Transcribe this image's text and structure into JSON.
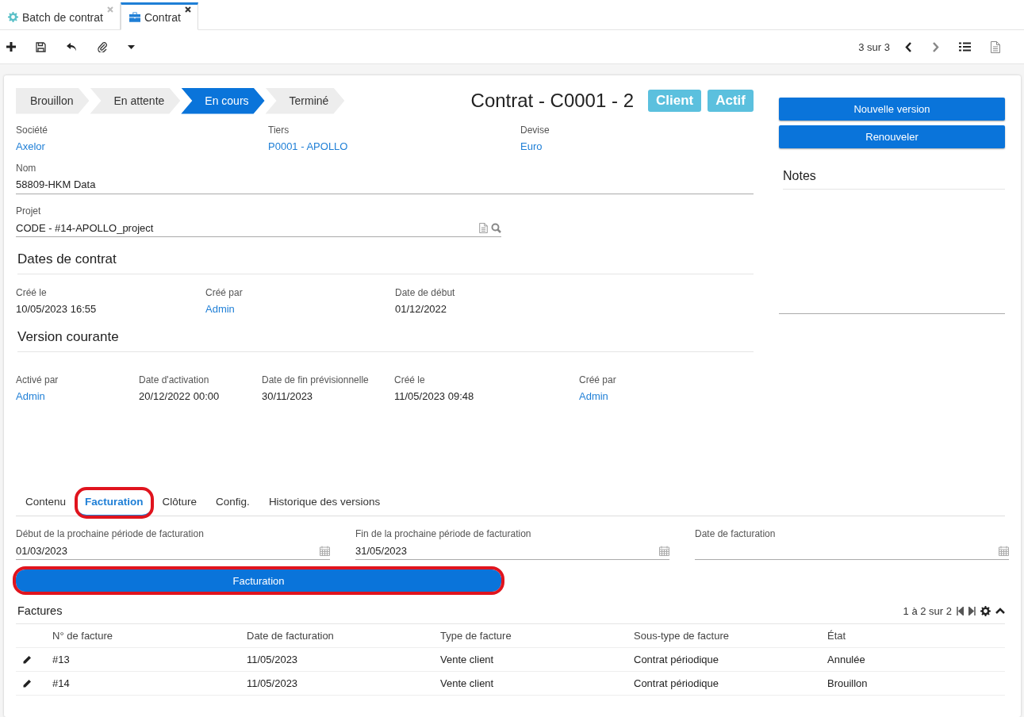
{
  "window_tabs": [
    {
      "label": "Batch de contrat",
      "kind": "batch",
      "selected": false
    },
    {
      "label": "Contrat",
      "kind": "record",
      "selected": true
    }
  ],
  "toolbar": {
    "pager": "3 sur 3"
  },
  "status_steps": [
    {
      "label": "Brouillon",
      "selected": false
    },
    {
      "label": "En attente",
      "selected": false
    },
    {
      "label": "En cours",
      "selected": true
    },
    {
      "label": "Terminé",
      "selected": false
    }
  ],
  "title": "Contrat - C0001 - 2",
  "tags": [
    "Client",
    "Actif"
  ],
  "main_fields": [
    {
      "label": "Société",
      "value": "Axelor",
      "link": true
    },
    {
      "label": "Tiers",
      "value": "P0001 - APOLLO",
      "link": true
    },
    {
      "label": "Devise",
      "value": "Euro",
      "link": true
    }
  ],
  "name_field": {
    "label": "Nom",
    "value": "58809-HKM Data"
  },
  "project_field": {
    "label": "Projet",
    "value": "CODE - #14-APOLLO_project"
  },
  "sections": [
    {
      "title": "Dates de contrat",
      "fields": [
        {
          "label": "Créé le",
          "value": "10/05/2023 16:55",
          "link": false
        },
        {
          "label": "Créé par",
          "value": "Admin",
          "link": true
        },
        {
          "label": "Date de début",
          "value": "01/12/2022",
          "link": false
        }
      ]
    },
    {
      "title": "Version courante",
      "fields": [
        {
          "label": "Activé par",
          "value": "Admin",
          "link": true
        },
        {
          "label": "Date d'activation",
          "value": "20/12/2022 00:00",
          "link": false
        },
        {
          "label": "Date de fin prévisionnelle",
          "value": "30/11/2023",
          "link": false
        },
        {
          "label": "Créé le",
          "value": "11/05/2023 09:48",
          "link": false
        },
        {
          "label": "Créé par",
          "value": "Admin",
          "link": true
        }
      ]
    }
  ],
  "side_buttons": [
    "Nouvelle version",
    "Renouveler"
  ],
  "notes_title": "Notes",
  "form_tabs": [
    {
      "label": "Contenu",
      "selected": false,
      "highlighted": false
    },
    {
      "label": "Facturation",
      "selected": true,
      "highlighted": true
    },
    {
      "label": "Clôture",
      "selected": false,
      "highlighted": false
    },
    {
      "label": "Config.",
      "selected": false,
      "highlighted": false
    },
    {
      "label": "Historique des versions",
      "selected": false,
      "highlighted": false
    }
  ],
  "billing_fields": [
    {
      "label": "Début de la prochaine période de facturation",
      "value": "01/03/2023"
    },
    {
      "label": "Fin de la prochaine période de facturation",
      "value": "31/05/2023"
    },
    {
      "label": "Date de facturation"
    }
  ],
  "billing_button": {
    "label": "Facturation",
    "highlighted": true
  },
  "invoices": {
    "title": "Factures",
    "pager": "1 à 2 sur 2",
    "columns": [
      "N° de facture",
      "Date de facturation",
      "Type de facture",
      "Sous-type de facture",
      "État"
    ],
    "rows": [
      [
        "#13",
        "11/05/2023",
        "Vente client",
        "Contrat périodique",
        "Annulée"
      ],
      [
        "#14",
        "11/05/2023",
        "Vente client",
        "Contrat périodique",
        "Brouillon"
      ]
    ]
  }
}
